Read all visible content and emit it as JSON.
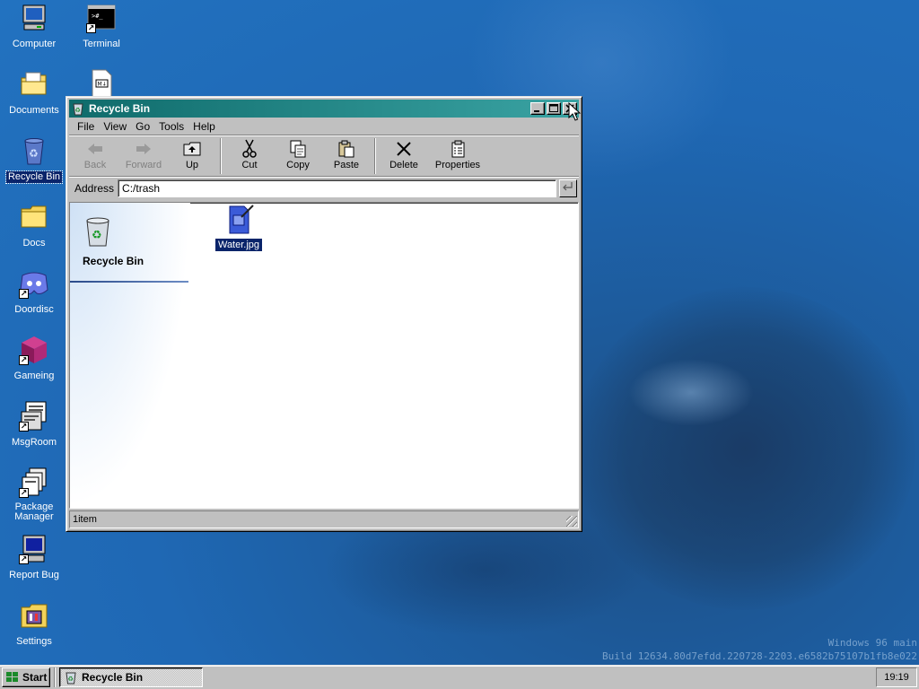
{
  "desktop": {
    "icons": [
      {
        "label": "Computer",
        "icon": "computer-icon"
      },
      {
        "label": "Terminal",
        "icon": "terminal-icon"
      },
      {
        "label": "Documents",
        "icon": "documents-folder-icon"
      },
      {
        "label": "",
        "icon": "markdown-file-icon"
      },
      {
        "label": "Recycle Bin",
        "icon": "recycle-bin-icon",
        "selected": true
      },
      {
        "label": "Docs",
        "icon": "folder-icon"
      },
      {
        "label": "Doordisc",
        "icon": "doordisc-icon"
      },
      {
        "label": "Gameing",
        "icon": "cube-icon"
      },
      {
        "label": "MsgRoom",
        "icon": "msgroom-icon"
      },
      {
        "label": "Package Manager",
        "icon": "package-manager-icon"
      },
      {
        "label": "Report Bug",
        "icon": "report-bug-icon"
      },
      {
        "label": "Settings",
        "icon": "settings-icon"
      }
    ],
    "build_line1": "Windows 96 main",
    "build_line2": "Build 12634.80d7efdd.220728-2203.e6582b75107b1fb8e022"
  },
  "window": {
    "title": "Recycle Bin",
    "menu": [
      "File",
      "View",
      "Go",
      "Tools",
      "Help"
    ],
    "toolbar": {
      "back": "Back",
      "forward": "Forward",
      "up": "Up",
      "cut": "Cut",
      "copy": "Copy",
      "paste": "Paste",
      "delete": "Delete",
      "properties": "Properties"
    },
    "address_label": "Address",
    "address_value": "C:/trash",
    "panel_title": "Recycle Bin",
    "files": [
      {
        "name": "Water.jpg",
        "icon": "image-file-icon",
        "selected": true
      }
    ],
    "status": "1item"
  },
  "taskbar": {
    "start_label": "Start",
    "tasks": [
      {
        "label": "Recycle Bin",
        "icon": "recycle-bin-icon",
        "active": true
      }
    ],
    "clock": "19:19"
  },
  "colors": {
    "titlebar_start": "#0f6b6b",
    "titlebar_end": "#3aa3a3",
    "selection": "#0a246a",
    "face": "#c0c0c0",
    "desktop": "#1f68b4"
  }
}
